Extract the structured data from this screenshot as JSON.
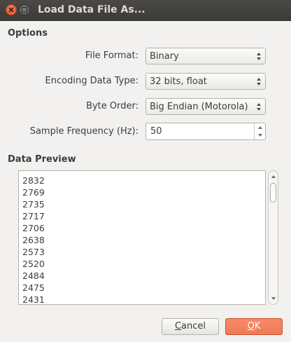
{
  "window": {
    "title": "Load Data File As..."
  },
  "options": {
    "heading": "Options",
    "file_format": {
      "label": "File Format:",
      "value": "Binary"
    },
    "encoding_data_type": {
      "label": "Encoding Data Type:",
      "value": "32 bits, float"
    },
    "byte_order": {
      "label": "Byte Order:",
      "value": "Big Endian (Motorola)"
    },
    "sample_frequency": {
      "label": "Sample Frequency (Hz):",
      "value": "50"
    }
  },
  "preview": {
    "heading": "Data Preview",
    "lines": [
      "2832",
      "2769",
      "2735",
      "2717",
      "2706",
      "2638",
      "2573",
      "2520",
      "2484",
      "2475",
      "2431"
    ]
  },
  "buttons": {
    "cancel_mnemonic": "C",
    "cancel_rest": "ancel",
    "ok_mnemonic": "O",
    "ok_rest": "K"
  }
}
